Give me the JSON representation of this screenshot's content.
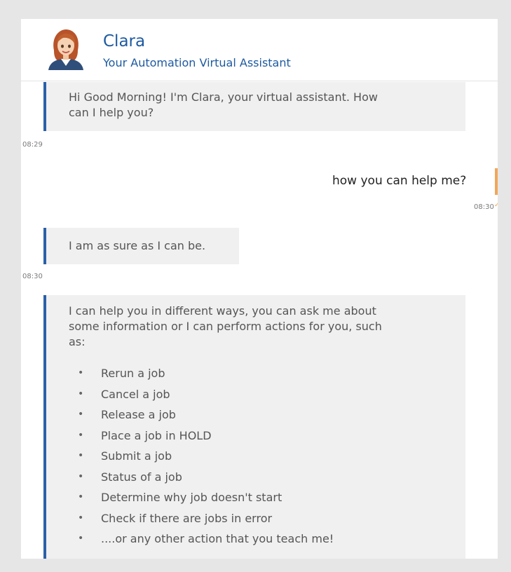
{
  "header": {
    "name": "Clara",
    "subtitle": "Your Automation Virtual Assistant",
    "avatar_icon": "female-assistant-avatar-icon"
  },
  "messages": {
    "greeting": {
      "line1": "Hi Good Morning! I'm Clara, your virtual assistant. How",
      "line2": "can I help you?",
      "time": "08:29"
    },
    "user_question": {
      "text": "how you can help me?",
      "time": "08:30"
    },
    "sure": {
      "text": "I am as sure as I can be.",
      "time": "08:30"
    },
    "help": {
      "line1": "I can help you in different ways, you can ask me about",
      "line2": "some information or I can perform actions for you, such",
      "line3": "as:",
      "items": [
        "Rerun a job",
        "Cancel a job",
        "Release a job",
        "Place a job in HOLD",
        "Submit a job",
        "Status of a job",
        "Determine why job doesn't start",
        "Check if there are jobs in error",
        "....or any other action that you teach me!"
      ]
    }
  },
  "colors": {
    "accent_blue": "#2a60a8",
    "title_blue": "#1e5aa0",
    "user_accent": "#f2a65a",
    "bubble_bg": "#f0f0f0"
  }
}
